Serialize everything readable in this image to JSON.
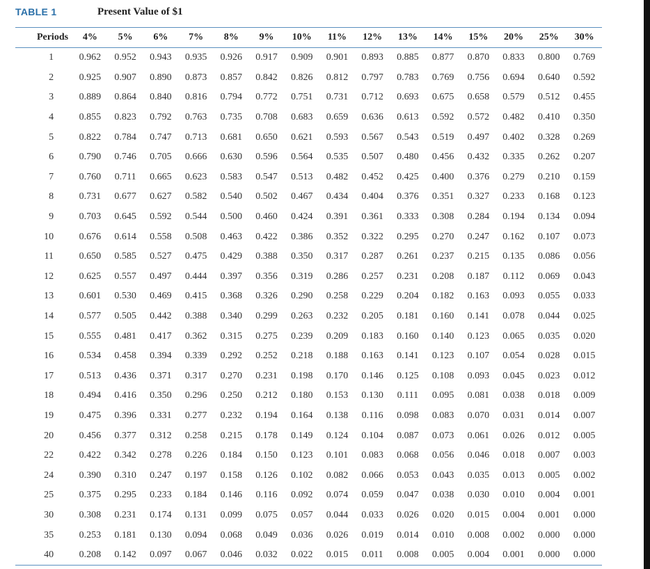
{
  "header": {
    "label": "TABLE 1",
    "title": "Present Value of $1"
  },
  "table": {
    "columns": [
      "Periods",
      "4%",
      "5%",
      "6%",
      "7%",
      "8%",
      "9%",
      "10%",
      "11%",
      "12%",
      "13%",
      "14%",
      "15%",
      "20%",
      "25%",
      "30%"
    ],
    "rows": [
      [
        "1",
        "0.962",
        "0.952",
        "0.943",
        "0.935",
        "0.926",
        "0.917",
        "0.909",
        "0.901",
        "0.893",
        "0.885",
        "0.877",
        "0.870",
        "0.833",
        "0.800",
        "0.769"
      ],
      [
        "2",
        "0.925",
        "0.907",
        "0.890",
        "0.873",
        "0.857",
        "0.842",
        "0.826",
        "0.812",
        "0.797",
        "0.783",
        "0.769",
        "0.756",
        "0.694",
        "0.640",
        "0.592"
      ],
      [
        "3",
        "0.889",
        "0.864",
        "0.840",
        "0.816",
        "0.794",
        "0.772",
        "0.751",
        "0.731",
        "0.712",
        "0.693",
        "0.675",
        "0.658",
        "0.579",
        "0.512",
        "0.455"
      ],
      [
        "4",
        "0.855",
        "0.823",
        "0.792",
        "0.763",
        "0.735",
        "0.708",
        "0.683",
        "0.659",
        "0.636",
        "0.613",
        "0.592",
        "0.572",
        "0.482",
        "0.410",
        "0.350"
      ],
      [
        "5",
        "0.822",
        "0.784",
        "0.747",
        "0.713",
        "0.681",
        "0.650",
        "0.621",
        "0.593",
        "0.567",
        "0.543",
        "0.519",
        "0.497",
        "0.402",
        "0.328",
        "0.269"
      ],
      [
        "6",
        "0.790",
        "0.746",
        "0.705",
        "0.666",
        "0.630",
        "0.596",
        "0.564",
        "0.535",
        "0.507",
        "0.480",
        "0.456",
        "0.432",
        "0.335",
        "0.262",
        "0.207"
      ],
      [
        "7",
        "0.760",
        "0.711",
        "0.665",
        "0.623",
        "0.583",
        "0.547",
        "0.513",
        "0.482",
        "0.452",
        "0.425",
        "0.400",
        "0.376",
        "0.279",
        "0.210",
        "0.159"
      ],
      [
        "8",
        "0.731",
        "0.677",
        "0.627",
        "0.582",
        "0.540",
        "0.502",
        "0.467",
        "0.434",
        "0.404",
        "0.376",
        "0.351",
        "0.327",
        "0.233",
        "0.168",
        "0.123"
      ],
      [
        "9",
        "0.703",
        "0.645",
        "0.592",
        "0.544",
        "0.500",
        "0.460",
        "0.424",
        "0.391",
        "0.361",
        "0.333",
        "0.308",
        "0.284",
        "0.194",
        "0.134",
        "0.094"
      ],
      [
        "10",
        "0.676",
        "0.614",
        "0.558",
        "0.508",
        "0.463",
        "0.422",
        "0.386",
        "0.352",
        "0.322",
        "0.295",
        "0.270",
        "0.247",
        "0.162",
        "0.107",
        "0.073"
      ],
      [
        "11",
        "0.650",
        "0.585",
        "0.527",
        "0.475",
        "0.429",
        "0.388",
        "0.350",
        "0.317",
        "0.287",
        "0.261",
        "0.237",
        "0.215",
        "0.135",
        "0.086",
        "0.056"
      ],
      [
        "12",
        "0.625",
        "0.557",
        "0.497",
        "0.444",
        "0.397",
        "0.356",
        "0.319",
        "0.286",
        "0.257",
        "0.231",
        "0.208",
        "0.187",
        "0.112",
        "0.069",
        "0.043"
      ],
      [
        "13",
        "0.601",
        "0.530",
        "0.469",
        "0.415",
        "0.368",
        "0.326",
        "0.290",
        "0.258",
        "0.229",
        "0.204",
        "0.182",
        "0.163",
        "0.093",
        "0.055",
        "0.033"
      ],
      [
        "14",
        "0.577",
        "0.505",
        "0.442",
        "0.388",
        "0.340",
        "0.299",
        "0.263",
        "0.232",
        "0.205",
        "0.181",
        "0.160",
        "0.141",
        "0.078",
        "0.044",
        "0.025"
      ],
      [
        "15",
        "0.555",
        "0.481",
        "0.417",
        "0.362",
        "0.315",
        "0.275",
        "0.239",
        "0.209",
        "0.183",
        "0.160",
        "0.140",
        "0.123",
        "0.065",
        "0.035",
        "0.020"
      ],
      [
        "16",
        "0.534",
        "0.458",
        "0.394",
        "0.339",
        "0.292",
        "0.252",
        "0.218",
        "0.188",
        "0.163",
        "0.141",
        "0.123",
        "0.107",
        "0.054",
        "0.028",
        "0.015"
      ],
      [
        "17",
        "0.513",
        "0.436",
        "0.371",
        "0.317",
        "0.270",
        "0.231",
        "0.198",
        "0.170",
        "0.146",
        "0.125",
        "0.108",
        "0.093",
        "0.045",
        "0.023",
        "0.012"
      ],
      [
        "18",
        "0.494",
        "0.416",
        "0.350",
        "0.296",
        "0.250",
        "0.212",
        "0.180",
        "0.153",
        "0.130",
        "0.111",
        "0.095",
        "0.081",
        "0.038",
        "0.018",
        "0.009"
      ],
      [
        "19",
        "0.475",
        "0.396",
        "0.331",
        "0.277",
        "0.232",
        "0.194",
        "0.164",
        "0.138",
        "0.116",
        "0.098",
        "0.083",
        "0.070",
        "0.031",
        "0.014",
        "0.007"
      ],
      [
        "20",
        "0.456",
        "0.377",
        "0.312",
        "0.258",
        "0.215",
        "0.178",
        "0.149",
        "0.124",
        "0.104",
        "0.087",
        "0.073",
        "0.061",
        "0.026",
        "0.012",
        "0.005"
      ],
      [
        "22",
        "0.422",
        "0.342",
        "0.278",
        "0.226",
        "0.184",
        "0.150",
        "0.123",
        "0.101",
        "0.083",
        "0.068",
        "0.056",
        "0.046",
        "0.018",
        "0.007",
        "0.003"
      ],
      [
        "24",
        "0.390",
        "0.310",
        "0.247",
        "0.197",
        "0.158",
        "0.126",
        "0.102",
        "0.082",
        "0.066",
        "0.053",
        "0.043",
        "0.035",
        "0.013",
        "0.005",
        "0.002"
      ],
      [
        "25",
        "0.375",
        "0.295",
        "0.233",
        "0.184",
        "0.146",
        "0.116",
        "0.092",
        "0.074",
        "0.059",
        "0.047",
        "0.038",
        "0.030",
        "0.010",
        "0.004",
        "0.001"
      ],
      [
        "30",
        "0.308",
        "0.231",
        "0.174",
        "0.131",
        "0.099",
        "0.075",
        "0.057",
        "0.044",
        "0.033",
        "0.026",
        "0.020",
        "0.015",
        "0.004",
        "0.001",
        "0.000"
      ],
      [
        "35",
        "0.253",
        "0.181",
        "0.130",
        "0.094",
        "0.068",
        "0.049",
        "0.036",
        "0.026",
        "0.019",
        "0.014",
        "0.010",
        "0.008",
        "0.002",
        "0.000",
        "0.000"
      ],
      [
        "40",
        "0.208",
        "0.142",
        "0.097",
        "0.067",
        "0.046",
        "0.032",
        "0.022",
        "0.015",
        "0.011",
        "0.008",
        "0.005",
        "0.004",
        "0.001",
        "0.000",
        "0.000"
      ]
    ]
  },
  "colors": {
    "label": "#2a6fa8",
    "rule": "#5a8fbf",
    "side_bar": "#111111"
  }
}
